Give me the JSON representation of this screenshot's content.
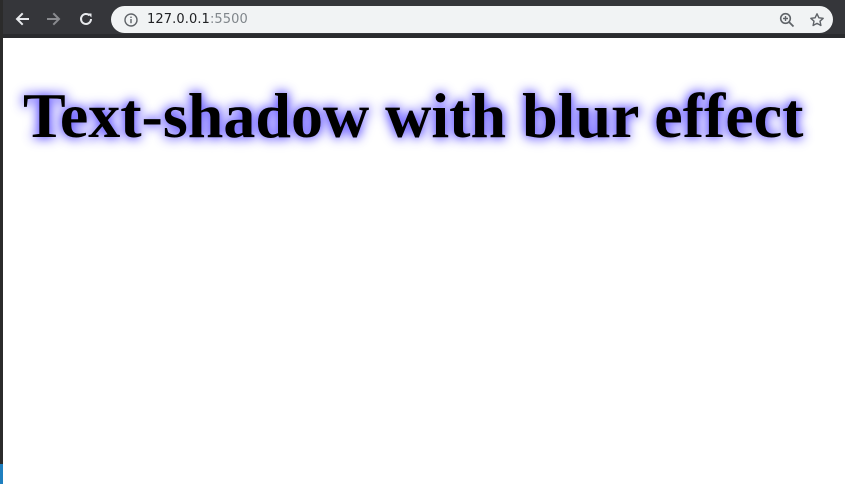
{
  "browser": {
    "url_host": "127.0.0.1",
    "url_port": ":5500",
    "icons": {
      "back": "arrow-left-icon",
      "forward": "arrow-right-icon",
      "reload": "reload-icon",
      "site_info": "info-icon",
      "zoom": "zoom-in-icon",
      "bookmark": "star-icon"
    },
    "colors": {
      "toolbar": "#35363a",
      "omnibox": "#f1f3f4"
    }
  },
  "page": {
    "heading": "Text-shadow with blur effect",
    "heading_color": "#000000",
    "shadow_color": "#5c4dff"
  }
}
